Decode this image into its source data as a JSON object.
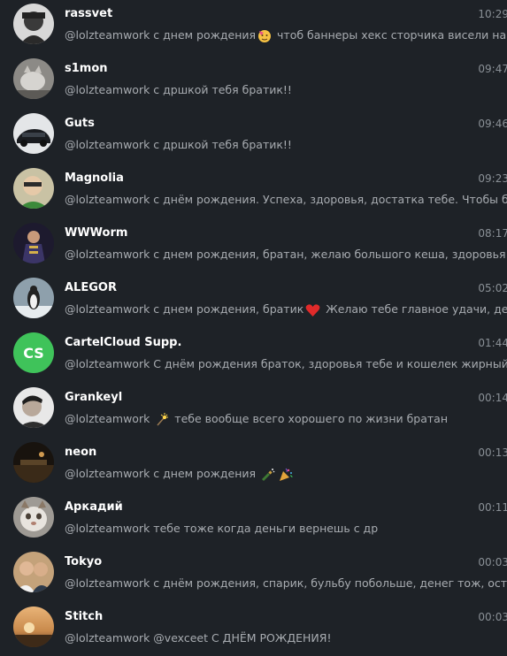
{
  "chats": [
    {
      "name": "rassvet",
      "time": "10:29",
      "preview": "@lolzteamwork с днем рождения",
      "preview_after": " чтоб баннеры хекс сторчика висели на та...",
      "emoji": "party-face-icon"
    },
    {
      "name": "s1mon",
      "time": "09:47",
      "preview": "@lolzteamwork с дршкой тебя братик!!"
    },
    {
      "name": "Guts",
      "time": "09:46",
      "preview": "@lolzteamwork с дршкой тебя братик!!"
    },
    {
      "name": "Magnolia",
      "time": "09:23",
      "preview": "@lolzteamwork с днём рождения. Успеха, здоровья, достатка тебе. Чтобы бабы..."
    },
    {
      "name": "WWWorm",
      "time": "08:17",
      "preview": "@lolzteamwork с днем рождения, братан, желаю большого кеша, здоровья те..."
    },
    {
      "name": "ALEGOR",
      "time": "05:02",
      "preview": "@lolzteamwork с днем рождения, братик",
      "preview_after": " Желаю тебе главное удачи, денег ...",
      "emoji": "red-heart-icon"
    },
    {
      "name": "CartelCloud Supp.",
      "time": "01:44",
      "initials": "CS",
      "preview": "@lolzteamwork С днём рождения браток, здоровья тебе и кошелек жирный ..."
    },
    {
      "name": "Grankeyl",
      "time": "00:14",
      "preview": "@lolzteamwork ",
      "preview_after": " тебе вообще всего хорошего по жизни братан",
      "emoji": "sparkler-icon"
    },
    {
      "name": "neon",
      "time": "00:13",
      "preview": "@lolzteamwork с днем рождения",
      "emoji": "bottle-popping-icon",
      "emoji2": "party-popper-icon"
    },
    {
      "name": "Аркадий",
      "time": "00:11",
      "preview": "@lolzteamwork тебе тоже когда деньги вернешь с др"
    },
    {
      "name": "Tokyo",
      "time": "00:03",
      "preview": "@lolzteamwork с днём рождения, спарик, бульбу побольше, денег тож, осталь..."
    },
    {
      "name": "Stitch",
      "time": "00:03",
      "preview": "@lolzteamwork @vexceet С ДНЁМ РОЖДЕНИЯ!"
    }
  ],
  "colors": {
    "background": "#1e2227",
    "name": "#ffffff",
    "preview": "#a8acb1",
    "time": "#8a9096",
    "initials_avatar": "#3fc35a"
  }
}
